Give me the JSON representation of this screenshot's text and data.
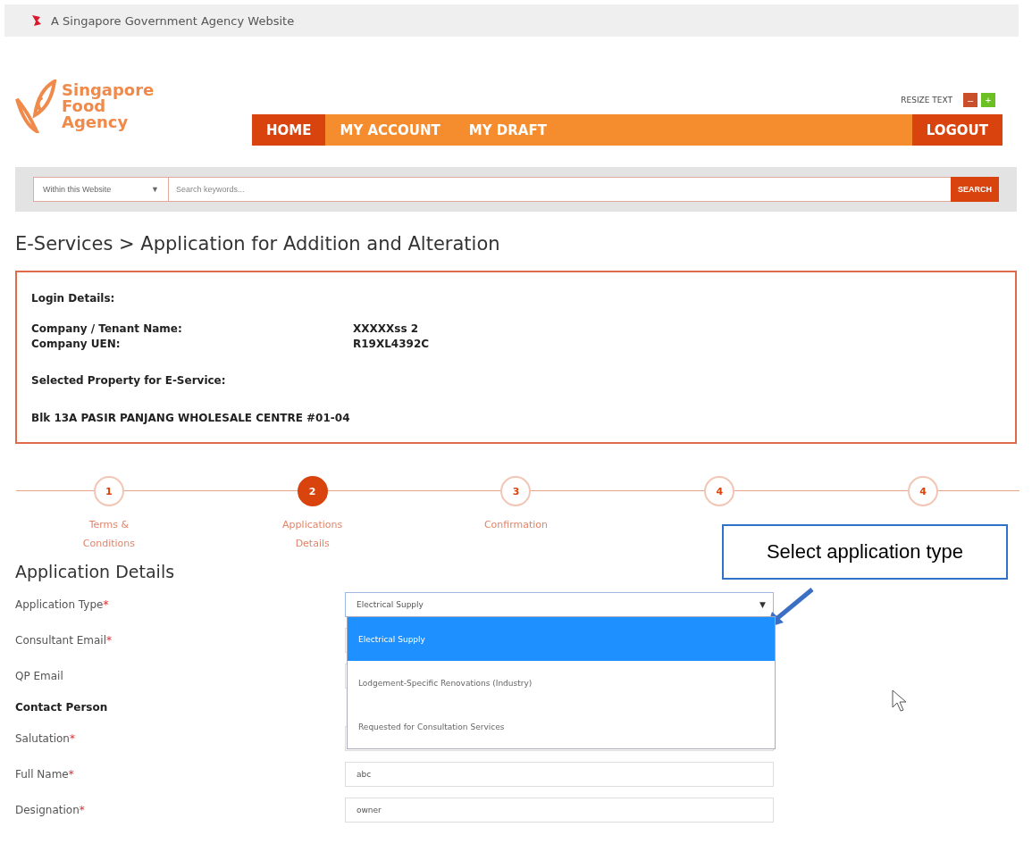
{
  "gov_bar": {
    "text": "A Singapore Government Agency Website"
  },
  "logo": {
    "lines": [
      "Singapore",
      "Food",
      "Agency"
    ]
  },
  "resize_text": {
    "label": "RESIZE TEXT",
    "decrease": "–",
    "increase": "+"
  },
  "nav": {
    "items": [
      {
        "label": "HOME",
        "selected": true
      },
      {
        "label": "MY ACCOUNT",
        "selected": false
      },
      {
        "label": "MY DRAFT",
        "selected": false
      }
    ],
    "logout": "LOGOUT"
  },
  "search": {
    "scope": "Within this Website",
    "caret": "▼",
    "placeholder": "Search keywords...",
    "button": "SEARCH"
  },
  "breadcrumb": "E-Services > Application for Addition and Alteration",
  "login_details": {
    "title": "Login Details:",
    "rows": [
      {
        "label": "Company / Tenant Name:",
        "value": "XXXXXss 2"
      },
      {
        "label": "Company UEN:",
        "value": "R19XL4392C"
      }
    ],
    "property_title": "Selected Property for E-Service:",
    "property": "Blk 13A PASIR PANJANG WHOLESALE CENTRE #01-04"
  },
  "steps": [
    {
      "number": "1",
      "label": [
        "Terms &",
        "Conditions"
      ],
      "selected": false
    },
    {
      "number": "2",
      "label": [
        "Applications",
        "Details"
      ],
      "selected": true
    },
    {
      "number": "3",
      "label": [
        "Confirmation"
      ],
      "selected": false
    },
    {
      "number": "4",
      "selected": false
    },
    {
      "number": "4",
      "selected": false
    }
  ],
  "callout": "Select application type",
  "form": {
    "title": "Application Details",
    "required_mark": "*",
    "rows": [
      {
        "kind": "select",
        "label": "Application Type",
        "required": true,
        "value": "Electrical Supply",
        "caret": "▼",
        "expanded": true,
        "options": [
          {
            "label": "Electrical Supply",
            "selected": true
          },
          {
            "label": "Lodgement-Specific Renovations (Industry)",
            "selected": false
          },
          {
            "label": "Requested for Consultation Services",
            "selected": false
          }
        ]
      },
      {
        "kind": "input",
        "label": "Consultant Email",
        "required": true
      },
      {
        "kind": "input",
        "label": "QP Email",
        "required": false
      },
      {
        "kind": "section",
        "label": "Contact Person"
      },
      {
        "kind": "input",
        "label": "Salutation",
        "required": true
      },
      {
        "kind": "input",
        "label": "Full Name",
        "required": true,
        "value": "abc"
      },
      {
        "kind": "input",
        "label": "Designation",
        "required": true,
        "value": "owner"
      }
    ]
  }
}
